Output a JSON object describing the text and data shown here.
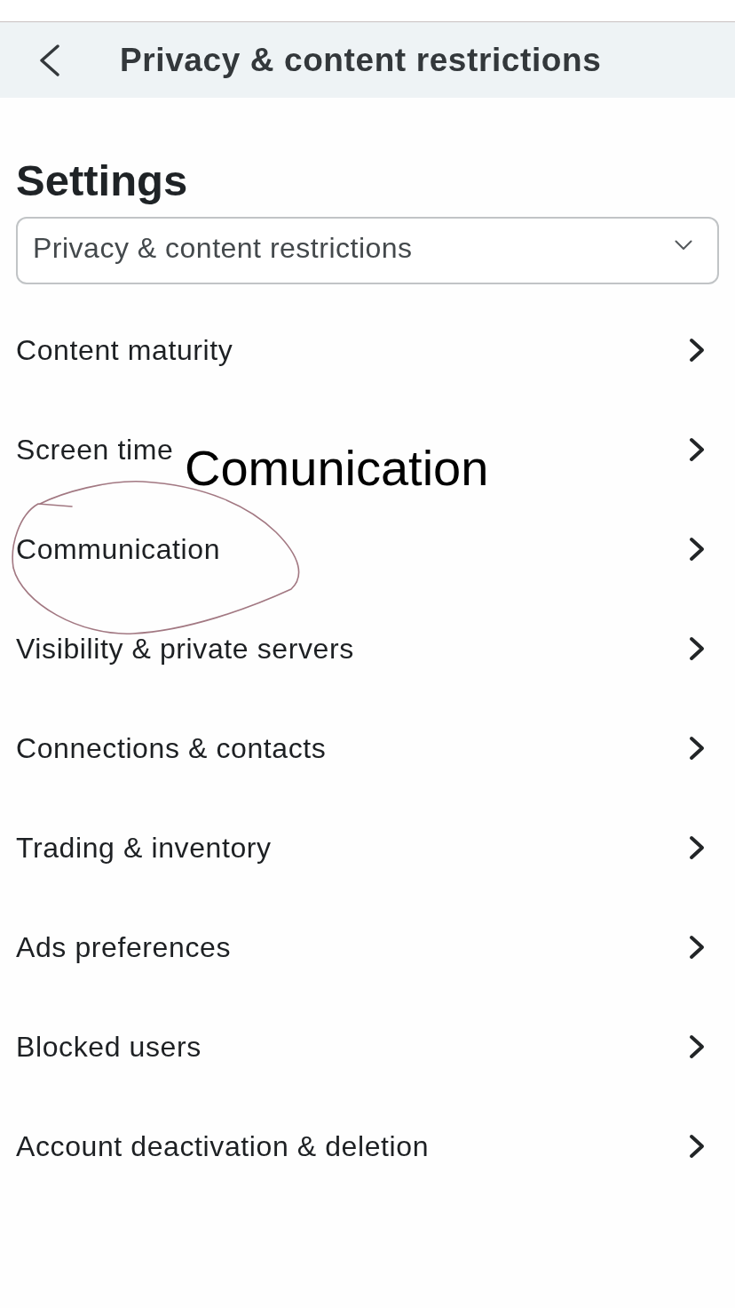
{
  "header": {
    "title": "Privacy & content restrictions"
  },
  "page_title": "Settings",
  "section_select": {
    "value": "Privacy & content restrictions"
  },
  "menu_items": [
    {
      "label": "Content maturity",
      "circled": false
    },
    {
      "label": "Screen time",
      "circled": false
    },
    {
      "label": "Communication",
      "circled": true
    },
    {
      "label": "Visibility & private servers",
      "circled": false
    },
    {
      "label": "Connections & contacts",
      "circled": false
    },
    {
      "label": "Trading & inventory",
      "circled": false
    },
    {
      "label": "Ads preferences",
      "circled": false
    },
    {
      "label": "Blocked users",
      "circled": false
    },
    {
      "label": "Account deactivation & deletion",
      "circled": false
    }
  ],
  "annotation": {
    "text": "Comunication"
  }
}
